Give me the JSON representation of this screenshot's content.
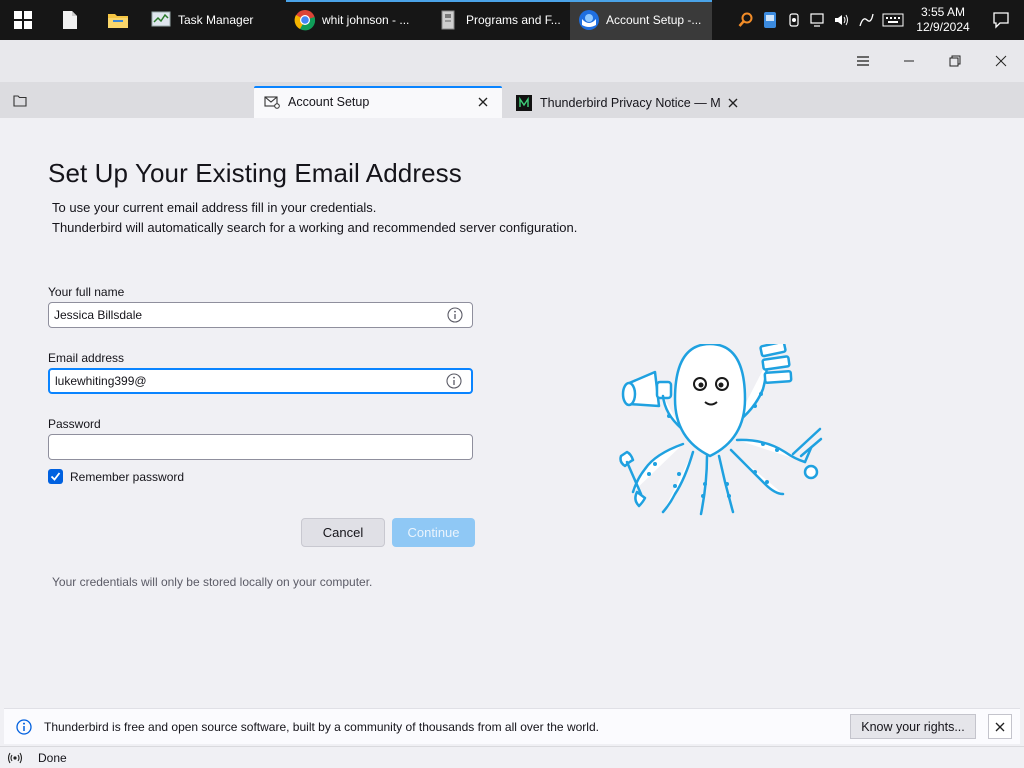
{
  "taskbar": {
    "apps": [
      {
        "label": "Task Manager",
        "icon": "task-manager-icon"
      },
      {
        "label": "whit johnson - ...",
        "icon": "chrome-icon"
      },
      {
        "label": "Programs and F...",
        "icon": "programs-features-icon"
      },
      {
        "label": "Account Setup -...",
        "icon": "thunderbird-icon"
      }
    ],
    "clock": {
      "time": "3:55 AM",
      "date": "12/9/2024"
    }
  },
  "tabs": [
    {
      "label": "Account Setup",
      "icon": "mail-settings-icon"
    },
    {
      "label": "Thunderbird Privacy Notice — Mozilla",
      "icon": "mozilla-icon"
    }
  ],
  "form": {
    "heading": "Set Up Your Existing Email Address",
    "desc_line1": "To use your current email address fill in your credentials.",
    "desc_line2": "Thunderbird will automatically search for a working and recommended server configuration.",
    "name_label": "Your full name",
    "name_value": "Jessica Billsdale",
    "email_label": "Email address",
    "email_value": "lukewhiting399@",
    "password_label": "Password",
    "password_value": "",
    "remember_label": "Remember password",
    "remember_checked": true,
    "cancel_label": "Cancel",
    "continue_label": "Continue",
    "note": "Your credentials will only be stored locally on your computer."
  },
  "notification": {
    "text": "Thunderbird is free and open source software, built by a community of thousands from all over the world.",
    "button": "Know your rights..."
  },
  "status": {
    "text": "Done"
  },
  "colors": {
    "accent": "#0a84ff",
    "checkbox": "#0061e0",
    "continue_disabled": "#8fc8f5"
  }
}
